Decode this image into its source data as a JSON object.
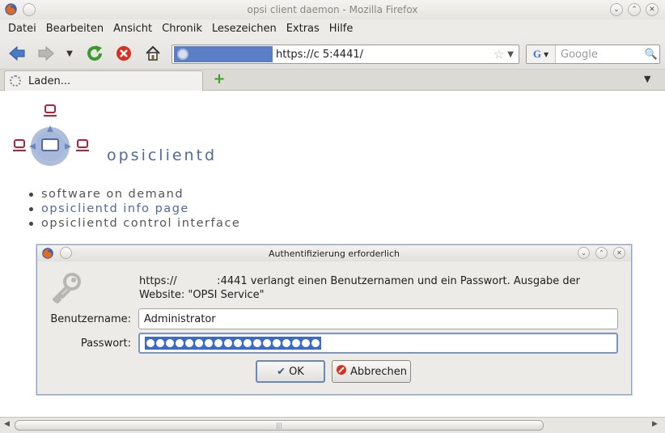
{
  "window": {
    "title": "opsi client daemon - Mozilla Firefox"
  },
  "menu": [
    {
      "label": "Datei"
    },
    {
      "label": "Bearbeiten"
    },
    {
      "label": "Ansicht"
    },
    {
      "label": "Chronik"
    },
    {
      "label": "Lesezeichen"
    },
    {
      "label": "Extras"
    },
    {
      "label": "Hilfe"
    }
  ],
  "navbar": {
    "url": "https://c              5:4441/",
    "search_placeholder": "Google"
  },
  "tabs": [
    {
      "label": "Laden..."
    }
  ],
  "page": {
    "brand": "opsiclientd",
    "links": [
      {
        "label": "software on demand",
        "kind": "plain"
      },
      {
        "label": "opsiclientd info page",
        "kind": "link"
      },
      {
        "label": "opsiclientd control interface",
        "kind": "plain"
      }
    ]
  },
  "auth_dialog": {
    "title": "Authentifizierung erforderlich",
    "message_line1": "https://            :4441 verlangt einen Benutzernamen und ein Passwort. Ausgabe der",
    "message_line2": "Website: \"OPSI Service\"",
    "username_label": "Benutzername:",
    "username_value": "Administrator",
    "password_label": "Passwort:",
    "password_masked_count": 18,
    "ok_label": "OK",
    "cancel_label": "Abbrechen"
  },
  "colors": {
    "brand": "#4f6a9e",
    "selection": "#3e69c4",
    "dialog_border": "#8fa3c6"
  }
}
